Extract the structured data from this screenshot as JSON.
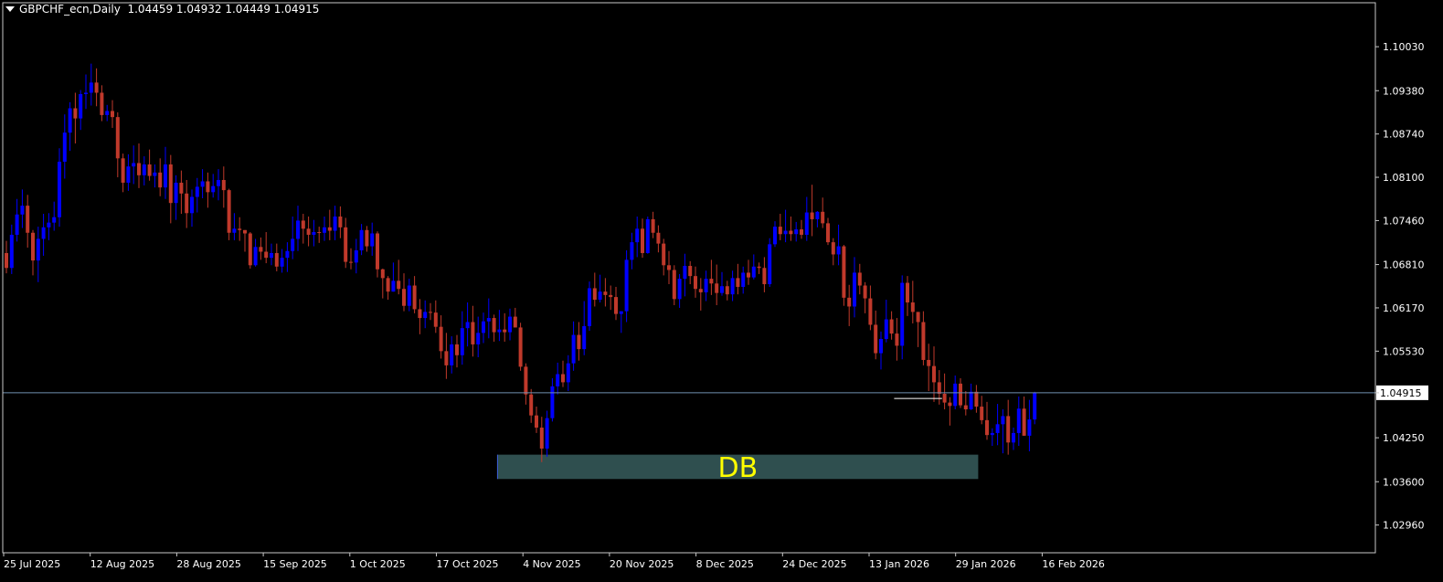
{
  "header": {
    "symbol_timeframe": "GBPCHF_ecn,Daily",
    "ohlc": "1.04459 1.04932 1.04449 1.04915"
  },
  "colors": {
    "background": "#000000",
    "frame": "#c8c8c8",
    "bull_candle": "#0000ff",
    "bear_candle": "#c0392b",
    "price_line": "#6f8fb0",
    "zone_fill": "#2f4f4f",
    "zone_label": "#ffff00",
    "text": "#ffffff"
  },
  "chart_data": {
    "type": "candlestick",
    "symbol": "GBPCHF_ecn",
    "timeframe": "Daily",
    "title": "GBPCHF_ecn,Daily",
    "last_price": "1.04915",
    "ylim": [
      1.0255,
      1.1068
    ],
    "y_ticks": [
      "1.10030",
      "1.09380",
      "1.08740",
      "1.08100",
      "1.07460",
      "1.06810",
      "1.06170",
      "1.05530",
      "1.04915",
      "1.04250",
      "1.03600",
      "1.02960"
    ],
    "x_labels": [
      "25 Jul 2025",
      "12 Aug 2025",
      "28 Aug 2025",
      "15 Sep 2025",
      "1 Oct 2025",
      "17 Oct 2025",
      "4 Nov 2025",
      "20 Nov 2025",
      "8 Dec 2025",
      "24 Dec 2025",
      "13 Jan 2026",
      "29 Jan 2026",
      "16 Feb 2026"
    ],
    "zone": {
      "label": "DB",
      "price_high": 1.04,
      "price_low": 1.0364,
      "start_bar": 93,
      "end_bar": 183
    },
    "resistance_segment": {
      "price": 1.0483,
      "start_bar": 168,
      "end_bar": 176
    },
    "candles": [
      [
        1.0698,
        1.0716,
        1.0668,
        1.0676
      ],
      [
        1.0676,
        1.074,
        1.0667,
        1.0725
      ],
      [
        1.0725,
        1.0778,
        1.0715,
        1.0755
      ],
      [
        1.0755,
        1.0792,
        1.0735,
        1.0768
      ],
      [
        1.0768,
        1.0784,
        1.0706,
        1.0728
      ],
      [
        1.0728,
        1.0732,
        1.0665,
        1.0687
      ],
      [
        1.0687,
        1.0737,
        1.0655,
        1.0719
      ],
      [
        1.0719,
        1.0756,
        1.0694,
        1.0736
      ],
      [
        1.0736,
        1.0757,
        1.0717,
        1.0743
      ],
      [
        1.0743,
        1.0774,
        1.0731,
        1.0751
      ],
      [
        1.0751,
        1.0853,
        1.0737,
        1.0833
      ],
      [
        1.0833,
        1.0903,
        1.0808,
        1.0876
      ],
      [
        1.0876,
        1.0921,
        1.0849,
        1.0912
      ],
      [
        1.0912,
        1.0935,
        1.086,
        1.0897
      ],
      [
        1.0897,
        1.0939,
        1.088,
        1.0933
      ],
      [
        1.0933,
        1.0962,
        1.0911,
        1.0935
      ],
      [
        1.0935,
        1.0978,
        1.0916,
        1.095
      ],
      [
        1.095,
        1.0971,
        1.0915,
        1.0935
      ],
      [
        1.0935,
        1.0946,
        1.0893,
        1.0902
      ],
      [
        1.0902,
        1.0917,
        1.0893,
        1.0908
      ],
      [
        1.0908,
        1.0924,
        1.0883,
        1.0899
      ],
      [
        1.0899,
        1.0906,
        1.081,
        1.0838
      ],
      [
        1.0838,
        1.0845,
        1.0788,
        1.0802
      ],
      [
        1.0802,
        1.0844,
        1.079,
        1.0826
      ],
      [
        1.0826,
        1.0857,
        1.08,
        1.0831
      ],
      [
        1.0831,
        1.086,
        1.0794,
        1.0813
      ],
      [
        1.0813,
        1.0841,
        1.0798,
        1.0829
      ],
      [
        1.0829,
        1.0851,
        1.0805,
        1.0812
      ],
      [
        1.0812,
        1.0829,
        1.0795,
        1.0817
      ],
      [
        1.0817,
        1.0838,
        1.0782,
        1.0795
      ],
      [
        1.0795,
        1.0855,
        1.0778,
        1.0829
      ],
      [
        1.0829,
        1.0843,
        1.0742,
        1.0772
      ],
      [
        1.0772,
        1.0813,
        1.0747,
        1.0802
      ],
      [
        1.0802,
        1.082,
        1.0756,
        1.0786
      ],
      [
        1.0786,
        1.0806,
        1.0735,
        1.0757
      ],
      [
        1.0757,
        1.0792,
        1.0737,
        1.0781
      ],
      [
        1.0781,
        1.0809,
        1.0758,
        1.0796
      ],
      [
        1.0796,
        1.0822,
        1.0779,
        1.0804
      ],
      [
        1.0804,
        1.0817,
        1.0765,
        1.0788
      ],
      [
        1.0788,
        1.0815,
        1.078,
        1.0797
      ],
      [
        1.0797,
        1.0822,
        1.0776,
        1.0806
      ],
      [
        1.0806,
        1.0826,
        1.0765,
        1.0791
      ],
      [
        1.0791,
        1.0793,
        1.0717,
        1.0728
      ],
      [
        1.0728,
        1.0757,
        1.0717,
        1.0734
      ],
      [
        1.0734,
        1.0751,
        1.0716,
        1.0732
      ],
      [
        1.0732,
        1.0732,
        1.07,
        1.0727
      ],
      [
        1.0727,
        1.0729,
        1.0675,
        1.068
      ],
      [
        1.068,
        1.0719,
        1.0678,
        1.0707
      ],
      [
        1.0707,
        1.0721,
        1.0688,
        1.07
      ],
      [
        1.07,
        1.0729,
        1.0683,
        1.0691
      ],
      [
        1.0691,
        1.0712,
        1.068,
        1.0698
      ],
      [
        1.0698,
        1.0712,
        1.0671,
        1.0678
      ],
      [
        1.0678,
        1.0704,
        1.0669,
        1.0691
      ],
      [
        1.0691,
        1.0714,
        1.067,
        1.0701
      ],
      [
        1.0701,
        1.0752,
        1.0689,
        1.0719
      ],
      [
        1.0719,
        1.0768,
        1.0701,
        1.0746
      ],
      [
        1.0746,
        1.0756,
        1.0712,
        1.0734
      ],
      [
        1.0734,
        1.0752,
        1.0708,
        1.0725
      ],
      [
        1.0725,
        1.0747,
        1.0708,
        1.0729
      ],
      [
        1.0729,
        1.0737,
        1.0713,
        1.0728
      ],
      [
        1.0728,
        1.0752,
        1.0716,
        1.0736
      ],
      [
        1.0736,
        1.0762,
        1.0717,
        1.0731
      ],
      [
        1.0731,
        1.0768,
        1.0717,
        1.0752
      ],
      [
        1.0752,
        1.0767,
        1.072,
        1.0736
      ],
      [
        1.0736,
        1.075,
        1.0676,
        1.0685
      ],
      [
        1.0685,
        1.0705,
        1.0674,
        1.0684
      ],
      [
        1.0684,
        1.0719,
        1.0668,
        1.0702
      ],
      [
        1.0702,
        1.0741,
        1.0695,
        1.0732
      ],
      [
        1.0732,
        1.0738,
        1.07,
        1.0708
      ],
      [
        1.0708,
        1.0743,
        1.0694,
        1.0727
      ],
      [
        1.0727,
        1.073,
        1.0662,
        1.0674
      ],
      [
        1.0674,
        1.0675,
        1.0631,
        1.0661
      ],
      [
        1.0661,
        1.0664,
        1.0629,
        1.0641
      ],
      [
        1.0641,
        1.0684,
        1.0641,
        1.0657
      ],
      [
        1.0657,
        1.0688,
        1.0637,
        1.0645
      ],
      [
        1.0645,
        1.0668,
        1.0612,
        1.062
      ],
      [
        1.062,
        1.066,
        1.0612,
        1.065
      ],
      [
        1.065,
        1.0664,
        1.0609,
        1.0615
      ],
      [
        1.0615,
        1.063,
        1.0578,
        1.0602
      ],
      [
        1.0602,
        1.0628,
        1.0587,
        1.0611
      ],
      [
        1.0611,
        1.0624,
        1.0599,
        1.061
      ],
      [
        1.061,
        1.0628,
        1.058,
        1.0589
      ],
      [
        1.0589,
        1.0606,
        1.0542,
        1.0553
      ],
      [
        1.0553,
        1.058,
        1.0512,
        1.0532
      ],
      [
        1.0532,
        1.0575,
        1.052,
        1.0563
      ],
      [
        1.0563,
        1.0577,
        1.0529,
        1.0547
      ],
      [
        1.0547,
        1.0612,
        1.0533,
        1.0587
      ],
      [
        1.0587,
        1.0625,
        1.056,
        1.0596
      ],
      [
        1.0596,
        1.062,
        1.0545,
        1.0563
      ],
      [
        1.0563,
        1.0604,
        1.0544,
        1.058
      ],
      [
        1.058,
        1.061,
        1.0565,
        1.0597
      ],
      [
        1.0597,
        1.0631,
        1.0572,
        1.0602
      ],
      [
        1.0602,
        1.0607,
        1.0567,
        1.0581
      ],
      [
        1.0581,
        1.0614,
        1.0568,
        1.0585
      ],
      [
        1.0585,
        1.0609,
        1.0567,
        1.0581
      ],
      [
        1.0581,
        1.0616,
        1.0569,
        1.0604
      ],
      [
        1.0604,
        1.0617,
        1.0588,
        1.0588
      ],
      [
        1.0588,
        1.0595,
        1.0524,
        1.053
      ],
      [
        1.053,
        1.0535,
        1.0474,
        1.0489
      ],
      [
        1.0489,
        1.0497,
        1.0447,
        1.0458
      ],
      [
        1.0458,
        1.0471,
        1.0432,
        1.044
      ],
      [
        1.044,
        1.0456,
        1.0389,
        1.0409
      ],
      [
        1.0409,
        1.0465,
        1.0397,
        1.0454
      ],
      [
        1.0454,
        1.0513,
        1.0449,
        1.0501
      ],
      [
        1.0501,
        1.0536,
        1.0489,
        1.0519
      ],
      [
        1.0519,
        1.0539,
        1.05,
        1.0507
      ],
      [
        1.0507,
        1.0547,
        1.0494,
        1.0535
      ],
      [
        1.0535,
        1.0597,
        1.0524,
        1.0577
      ],
      [
        1.0577,
        1.0596,
        1.0539,
        1.0556
      ],
      [
        1.0556,
        1.0627,
        1.0547,
        1.059
      ],
      [
        1.059,
        1.0656,
        1.0583,
        1.0646
      ],
      [
        1.0646,
        1.0669,
        1.0619,
        1.0629
      ],
      [
        1.0629,
        1.0666,
        1.0625,
        1.0641
      ],
      [
        1.0641,
        1.0661,
        1.0619,
        1.0636
      ],
      [
        1.0636,
        1.065,
        1.0614,
        1.0633
      ],
      [
        1.0633,
        1.0648,
        1.0599,
        1.0608
      ],
      [
        1.0608,
        1.0612,
        1.058,
        1.0612
      ],
      [
        1.0612,
        1.0702,
        1.0596,
        1.0688
      ],
      [
        1.0688,
        1.0728,
        1.0674,
        1.0714
      ],
      [
        1.0714,
        1.0752,
        1.0692,
        1.0734
      ],
      [
        1.0734,
        1.0749,
        1.0691,
        1.0698
      ],
      [
        1.0698,
        1.0752,
        1.0697,
        1.0748
      ],
      [
        1.0748,
        1.0759,
        1.072,
        1.0728
      ],
      [
        1.0728,
        1.0739,
        1.0699,
        1.0712
      ],
      [
        1.0712,
        1.0719,
        1.0665,
        1.068
      ],
      [
        1.068,
        1.0701,
        1.0652,
        1.0673
      ],
      [
        1.0673,
        1.068,
        1.0621,
        1.063
      ],
      [
        1.063,
        1.0667,
        1.0617,
        1.066
      ],
      [
        1.066,
        1.0697,
        1.0634,
        1.0679
      ],
      [
        1.0679,
        1.0686,
        1.0652,
        1.0664
      ],
      [
        1.0664,
        1.0678,
        1.0632,
        1.0645
      ],
      [
        1.0645,
        1.0661,
        1.0613,
        1.064
      ],
      [
        1.064,
        1.0672,
        1.0627,
        1.066
      ],
      [
        1.066,
        1.0688,
        1.0636,
        1.0653
      ],
      [
        1.0653,
        1.0681,
        1.0621,
        1.0639
      ],
      [
        1.0639,
        1.067,
        1.0635,
        1.0649
      ],
      [
        1.0649,
        1.0657,
        1.0628,
        1.0637
      ],
      [
        1.0637,
        1.0672,
        1.0627,
        1.0661
      ],
      [
        1.0661,
        1.0682,
        1.0637,
        1.0648
      ],
      [
        1.0648,
        1.0678,
        1.0638,
        1.0669
      ],
      [
        1.0669,
        1.0688,
        1.0651,
        1.0662
      ],
      [
        1.0662,
        1.0696,
        1.0659,
        1.0678
      ],
      [
        1.0678,
        1.0684,
        1.0667,
        1.0676
      ],
      [
        1.0676,
        1.0692,
        1.064,
        1.0652
      ],
      [
        1.0652,
        1.072,
        1.0648,
        1.0711
      ],
      [
        1.0711,
        1.0745,
        1.0707,
        1.0737
      ],
      [
        1.0737,
        1.0756,
        1.0717,
        1.0726
      ],
      [
        1.0726,
        1.0762,
        1.0714,
        1.0731
      ],
      [
        1.0731,
        1.0752,
        1.0716,
        1.0726
      ],
      [
        1.0726,
        1.0744,
        1.0715,
        1.0733
      ],
      [
        1.0733,
        1.0747,
        1.0719,
        1.0725
      ],
      [
        1.0725,
        1.0781,
        1.0716,
        1.0758
      ],
      [
        1.0758,
        1.0799,
        1.0723,
        1.0748
      ],
      [
        1.0748,
        1.076,
        1.0736,
        1.0759
      ],
      [
        1.0759,
        1.078,
        1.0735,
        1.0742
      ],
      [
        1.0742,
        1.075,
        1.071,
        1.0714
      ],
      [
        1.0714,
        1.072,
        1.068,
        1.0696
      ],
      [
        1.0696,
        1.074,
        1.068,
        1.0708
      ],
      [
        1.0708,
        1.071,
        1.062,
        1.0632
      ],
      [
        1.0632,
        1.0651,
        1.059,
        1.0619
      ],
      [
        1.0619,
        1.0692,
        1.0603,
        1.0669
      ],
      [
        1.0669,
        1.0682,
        1.0637,
        1.065
      ],
      [
        1.065,
        1.0655,
        1.0609,
        1.0631
      ],
      [
        1.0631,
        1.065,
        1.0584,
        1.0592
      ],
      [
        1.0592,
        1.0613,
        1.0541,
        1.055
      ],
      [
        1.055,
        1.0582,
        1.0526,
        1.0571
      ],
      [
        1.0571,
        1.0629,
        1.0566,
        1.06
      ],
      [
        1.06,
        1.0612,
        1.057,
        1.0579
      ],
      [
        1.0579,
        1.0602,
        1.0539,
        1.0561
      ],
      [
        1.0561,
        1.0665,
        1.0541,
        1.0654
      ],
      [
        1.0654,
        1.0664,
        1.0605,
        1.0625
      ],
      [
        1.0625,
        1.0657,
        1.0594,
        1.0611
      ],
      [
        1.0611,
        1.0611,
        1.0559,
        1.0596
      ],
      [
        1.0596,
        1.0612,
        1.0532,
        1.054
      ],
      [
        1.054,
        1.0564,
        1.0494,
        1.0531
      ],
      [
        1.0531,
        1.056,
        1.0478,
        1.0507
      ],
      [
        1.0507,
        1.0525,
        1.0474,
        1.049
      ],
      [
        1.049,
        1.052,
        1.0467,
        1.0477
      ],
      [
        1.0477,
        1.0485,
        1.0443,
        1.0472
      ],
      [
        1.0472,
        1.0517,
        1.0467,
        1.0505
      ],
      [
        1.0505,
        1.0513,
        1.0469,
        1.0473
      ],
      [
        1.0473,
        1.0494,
        1.0458,
        1.0467
      ],
      [
        1.0467,
        1.0505,
        1.0466,
        1.0493
      ],
      [
        1.0493,
        1.0503,
        1.0462,
        1.0471
      ],
      [
        1.0471,
        1.0487,
        1.0445,
        1.0451
      ],
      [
        1.0451,
        1.0478,
        1.0422,
        1.0429
      ],
      [
        1.0429,
        1.0439,
        1.0413,
        1.0432
      ],
      [
        1.0432,
        1.0475,
        1.0414,
        1.0445
      ],
      [
        1.0445,
        1.0467,
        1.0402,
        1.0457
      ],
      [
        1.0457,
        1.0481,
        1.04,
        1.0418
      ],
      [
        1.0418,
        1.044,
        1.0407,
        1.0432
      ],
      [
        1.0432,
        1.0486,
        1.0413,
        1.0468
      ],
      [
        1.0468,
        1.0486,
        1.0428,
        1.0428
      ],
      [
        1.0428,
        1.0481,
        1.0405,
        1.0452
      ],
      [
        1.0452,
        1.0493,
        1.0445,
        1.0492
      ]
    ]
  }
}
